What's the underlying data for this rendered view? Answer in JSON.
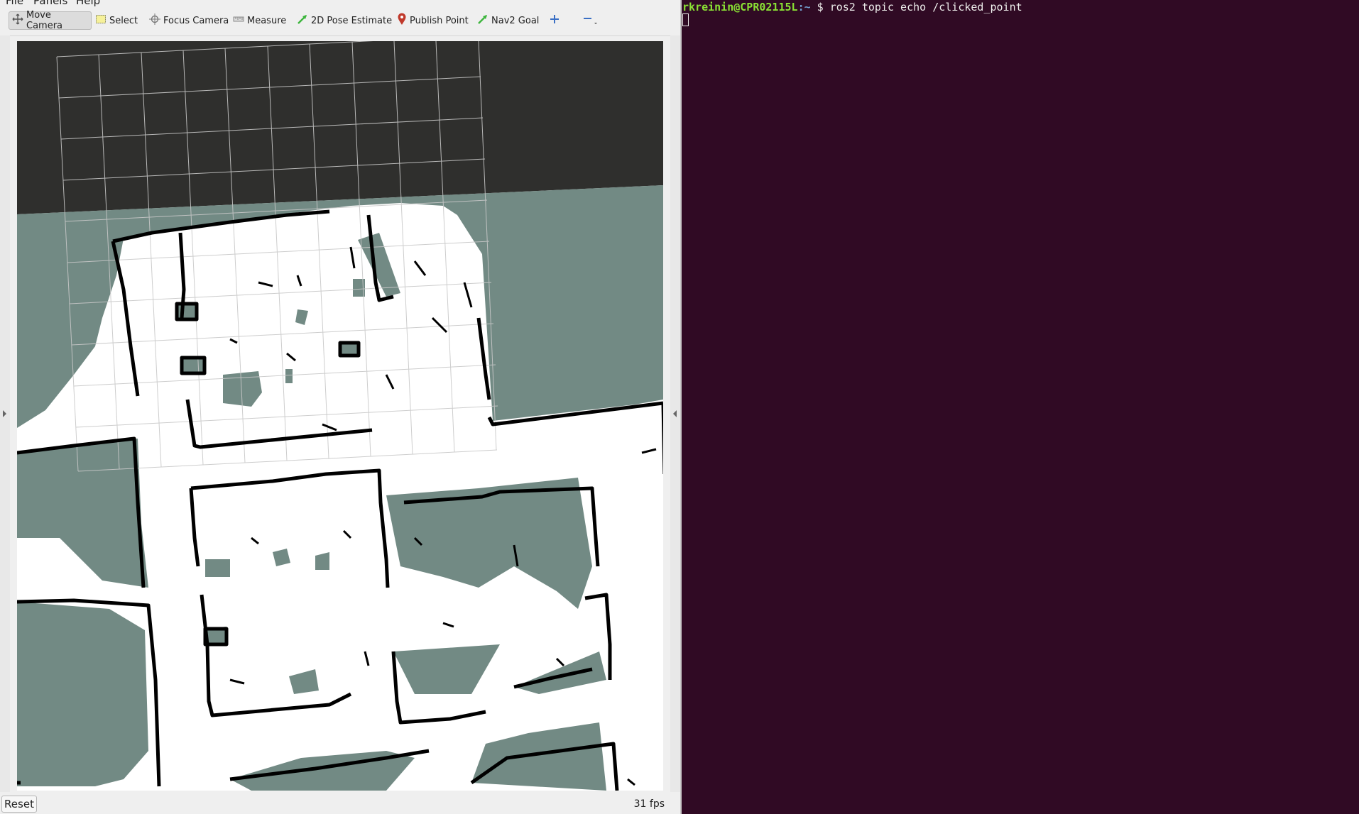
{
  "menubar": {
    "items": [
      {
        "label": "File"
      },
      {
        "label": "Panels"
      },
      {
        "label": "Help"
      }
    ]
  },
  "toolbar": {
    "tools": [
      {
        "label": "Move Camera",
        "icon": "move-camera-icon",
        "active": true
      },
      {
        "label": "Select",
        "icon": "select-icon"
      },
      {
        "label": "Focus Camera",
        "icon": "focus-camera-icon"
      },
      {
        "label": "Measure",
        "icon": "measure-icon"
      },
      {
        "label": "2D Pose Estimate",
        "icon": "pose-arrow-icon"
      },
      {
        "label": "Publish Point",
        "icon": "map-pin-icon"
      },
      {
        "label": "Nav2 Goal",
        "icon": "goal-arrow-icon"
      }
    ],
    "add_tool_icon": "plus-icon",
    "remove_tool_icon": "minus-icon"
  },
  "map": {
    "unknown_color": "#2f2f2d",
    "unexplored_color": "#728a84",
    "free_color": "#ffffff",
    "wall_color": "#000000",
    "grid_color": "#c8c8c8"
  },
  "status": {
    "reset_label": "Reset",
    "fps": "31 fps"
  },
  "terminal": {
    "user_host": "rkreinin@CPR02115L",
    "path": ":~",
    "prompt": " $ ",
    "command": "ros2 topic echo /clicked_point",
    "background": "#300a24"
  }
}
